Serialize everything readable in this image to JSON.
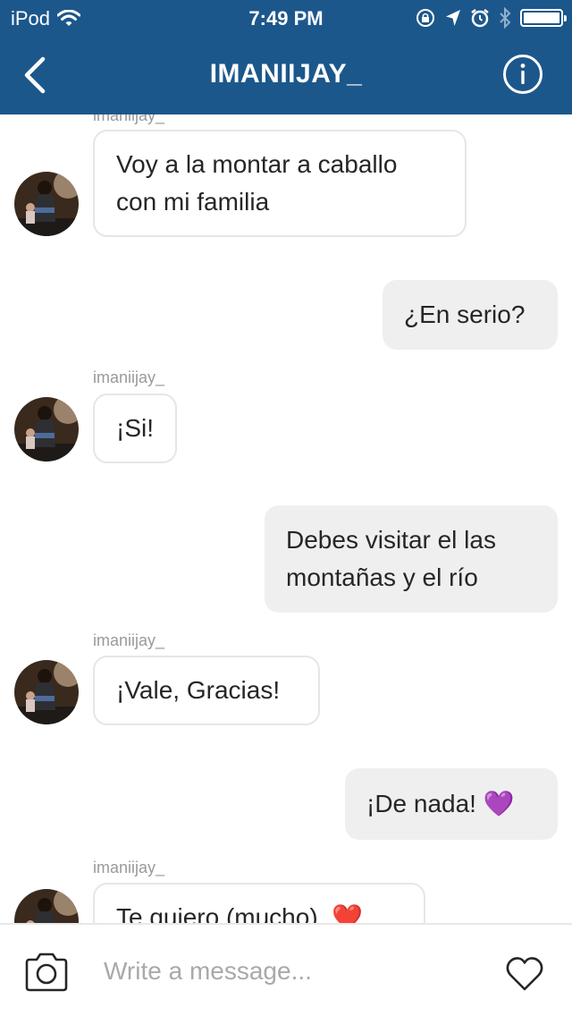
{
  "status_bar": {
    "carrier": "iPod",
    "time": "7:49 PM",
    "icons": [
      "wifi-icon",
      "orientation-lock-icon",
      "location-icon",
      "alarm-icon",
      "bluetooth-icon",
      "battery-icon"
    ],
    "battery_level": 1.0
  },
  "header": {
    "title": "IMANIIJAY_",
    "icons": [
      "back-chevron-icon",
      "info-icon"
    ],
    "background": "#1c578c"
  },
  "messages": [
    {
      "direction": "in",
      "sender": "imaniijay_",
      "lines": [
        "Voy a la montar a caballo",
        "con mi familia"
      ]
    },
    {
      "direction": "out",
      "lines": [
        "¿En serio?"
      ]
    },
    {
      "direction": "in",
      "sender": "imaniijay_",
      "lines": [
        "¡Si!"
      ]
    },
    {
      "direction": "out",
      "lines": [
        "Debes visitar el las",
        "montañas y el río"
      ]
    },
    {
      "direction": "in",
      "sender": "imaniijay_",
      "lines": [
        "¡Vale, Gracias!"
      ]
    },
    {
      "direction": "out",
      "lines": [
        "¡De nada! 💜"
      ]
    },
    {
      "direction": "in",
      "sender": "imaniijay_",
      "lines": [
        "Te quiero (mucho). ❤️"
      ]
    }
  ],
  "composer": {
    "placeholder": "Write a message...",
    "icons": [
      "camera-icon",
      "heart-icon"
    ]
  }
}
